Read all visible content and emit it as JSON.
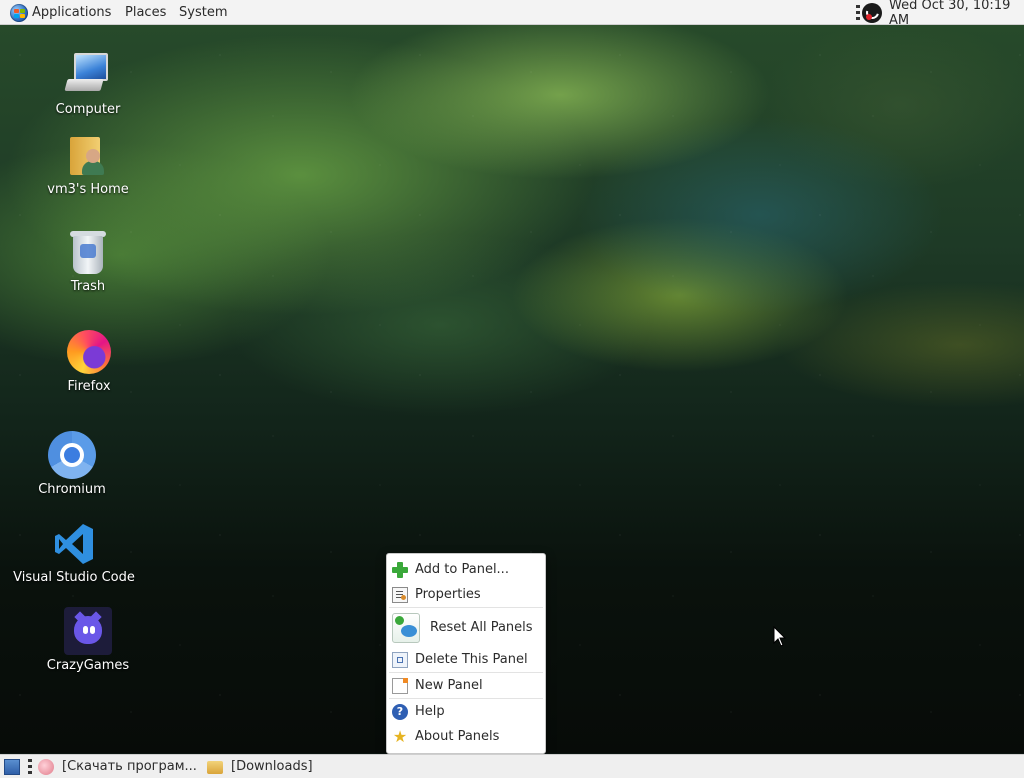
{
  "top_panel": {
    "menus": [
      "Applications",
      "Places",
      "System"
    ],
    "clock": "Wed Oct 30, 10:19 AM"
  },
  "desktop": {
    "icons": [
      {
        "label": "Computer",
        "icon": "computer-icon"
      },
      {
        "label": "vm3's Home",
        "icon": "home-folder-icon"
      },
      {
        "label": "Trash",
        "icon": "trash-icon"
      },
      {
        "label": "Firefox",
        "icon": "firefox-icon"
      },
      {
        "label": "Chromium",
        "icon": "chromium-icon"
      },
      {
        "label": "Visual Studio Code",
        "icon": "vscode-icon"
      },
      {
        "label": "CrazyGames",
        "icon": "crazygames-icon"
      }
    ]
  },
  "context_menu": {
    "items": [
      {
        "label": "Add to Panel...",
        "icon": "add-icon"
      },
      {
        "label": "Properties",
        "icon": "properties-icon"
      },
      {
        "label": "Reset All Panels",
        "icon": "reset-icon"
      },
      {
        "label": "Delete This Panel",
        "icon": "delete-panel-icon"
      },
      {
        "label": "New Panel",
        "icon": "new-panel-icon"
      },
      {
        "label": "Help",
        "icon": "help-icon"
      },
      {
        "label": "About Panels",
        "icon": "about-star-icon"
      }
    ]
  },
  "bottom_panel": {
    "tasks": [
      {
        "label": "[Скачать програм...",
        "icon": "app-icon"
      },
      {
        "label": "[Downloads]",
        "icon": "folder-icon"
      }
    ]
  }
}
